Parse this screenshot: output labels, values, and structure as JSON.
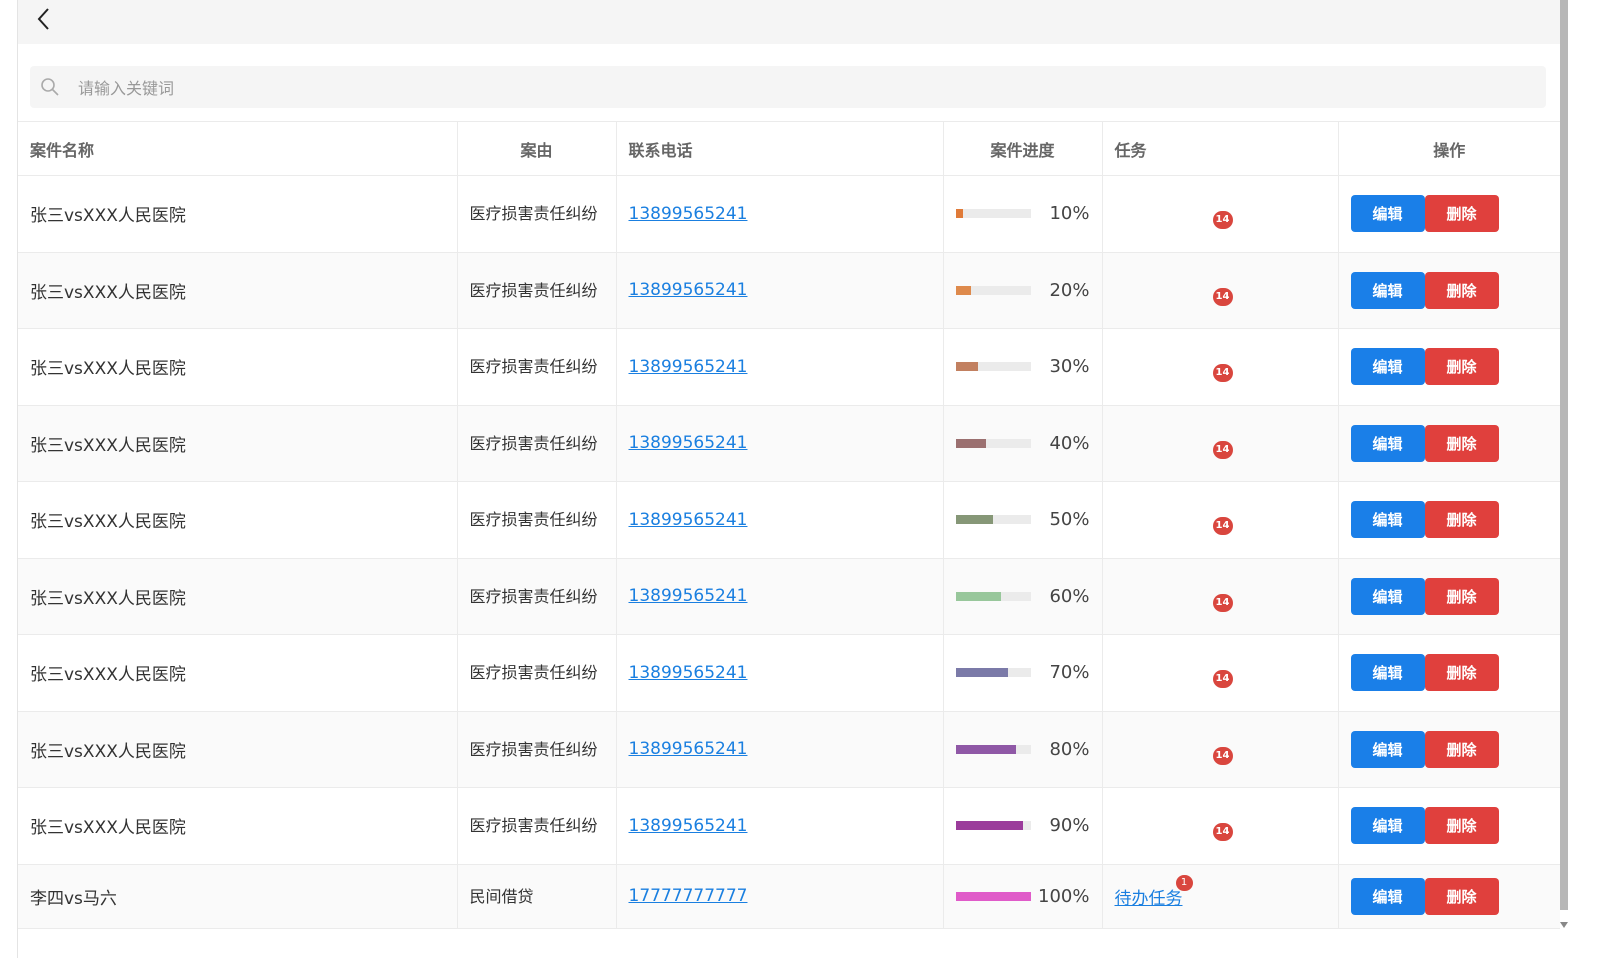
{
  "search": {
    "placeholder": "请输入关键词",
    "value": ""
  },
  "table": {
    "headers": {
      "name": "案件名称",
      "cause": "案由",
      "phone": "联系电话",
      "progress": "案件进度",
      "task": "任务",
      "ops": "操作"
    },
    "edit_label": "编辑",
    "delete_label": "删除",
    "rows": [
      {
        "name": "张三vsXXX人民医院",
        "cause": "医疗损害责任纠纷",
        "phone": "13899565241",
        "progress_pct": 10,
        "progress_label": "10%",
        "color": "#e07b39",
        "task_badge": "14"
      },
      {
        "name": "张三vsXXX人民医院",
        "cause": "医疗损害责任纠纷",
        "phone": "13899565241",
        "progress_pct": 20,
        "progress_label": "20%",
        "color": "#de8a4c",
        "task_badge": "14"
      },
      {
        "name": "张三vsXXX人民医院",
        "cause": "医疗损害责任纠纷",
        "phone": "13899565241",
        "progress_pct": 30,
        "progress_label": "30%",
        "color": "#c28060",
        "task_badge": "14"
      },
      {
        "name": "张三vsXXX人民医院",
        "cause": "医疗损害责任纠纷",
        "phone": "13899565241",
        "progress_pct": 40,
        "progress_label": "40%",
        "color": "#9b7070",
        "task_badge": "14"
      },
      {
        "name": "张三vsXXX人民医院",
        "cause": "医疗损害责任纠纷",
        "phone": "13899565241",
        "progress_pct": 50,
        "progress_label": "50%",
        "color": "#869777",
        "task_badge": "14"
      },
      {
        "name": "张三vsXXX人民医院",
        "cause": "医疗损害责任纠纷",
        "phone": "13899565241",
        "progress_pct": 60,
        "progress_label": "60%",
        "color": "#98c79b",
        "task_badge": "14"
      },
      {
        "name": "张三vsXXX人民医院",
        "cause": "医疗损害责任纠纷",
        "phone": "13899565241",
        "progress_pct": 70,
        "progress_label": "70%",
        "color": "#7b7aa8",
        "task_badge": "14"
      },
      {
        "name": "张三vsXXX人民医院",
        "cause": "医疗损害责任纠纷",
        "phone": "13899565241",
        "progress_pct": 80,
        "progress_label": "80%",
        "color": "#8f58a6",
        "task_badge": "14"
      },
      {
        "name": "张三vsXXX人民医院",
        "cause": "医疗损害责任纠纷",
        "phone": "13899565241",
        "progress_pct": 90,
        "progress_label": "90%",
        "color": "#9b3c9b",
        "task_badge": "14"
      },
      {
        "name": "李四vs马六",
        "cause": "民间借贷",
        "phone": "17777777777",
        "progress_pct": 100,
        "progress_label": "100%",
        "color": "#e05bc9",
        "task_link": "待办任务",
        "task_badge": "1"
      }
    ]
  }
}
